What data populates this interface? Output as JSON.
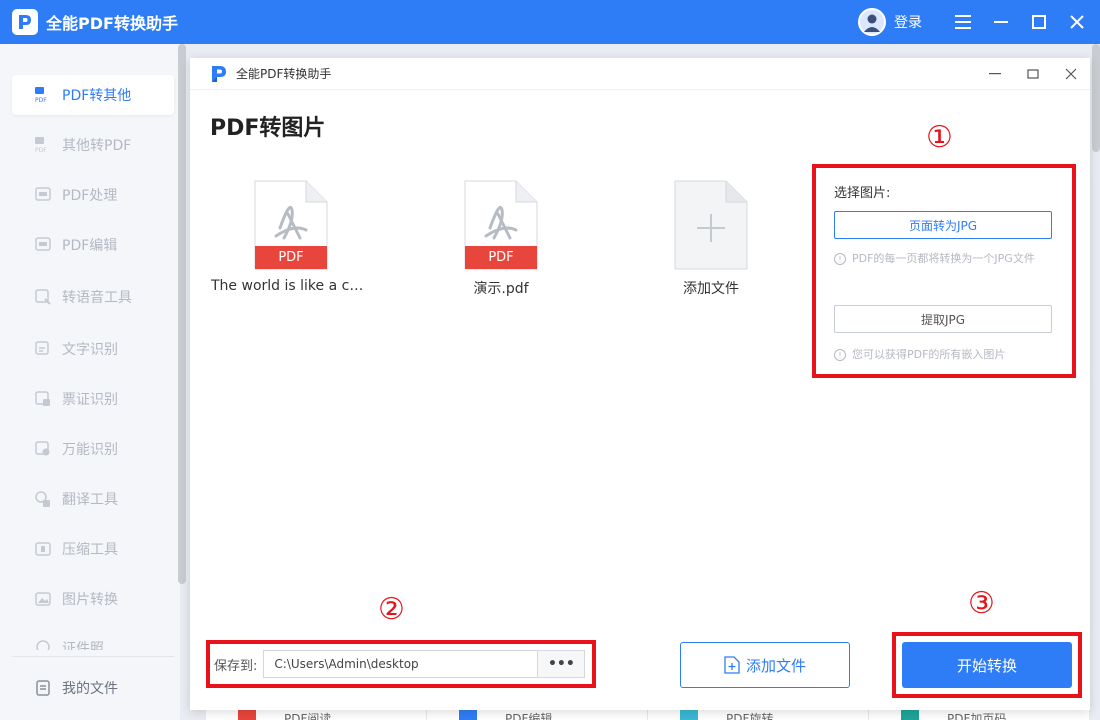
{
  "app": {
    "title": "全能PDF转换助手",
    "login_label": "登录"
  },
  "sidebar": {
    "items": [
      {
        "label": "PDF转其他",
        "icon": "pdf-convert-icon",
        "active": true
      },
      {
        "label": "其他转PDF",
        "icon": "to-pdf-icon"
      },
      {
        "label": "PDF处理",
        "icon": "pdf-process-icon"
      },
      {
        "label": "PDF编辑",
        "icon": "pdf-edit-icon"
      },
      {
        "label": "转语音工具",
        "icon": "voice-icon"
      },
      {
        "label": "文字识别",
        "icon": "ocr-icon"
      },
      {
        "label": "票证识别",
        "icon": "ticket-icon"
      },
      {
        "label": "万能识别",
        "icon": "universal-recognize-icon"
      },
      {
        "label": "翻译工具",
        "icon": "translate-icon"
      },
      {
        "label": "压缩工具",
        "icon": "compress-icon"
      },
      {
        "label": "图片转换",
        "icon": "image-convert-icon"
      },
      {
        "label": "证件照",
        "icon": "id-photo-icon"
      }
    ],
    "my_files_label": "我的文件"
  },
  "dialog": {
    "title": "全能PDF转换助手",
    "heading": "PDF转图片",
    "files": [
      {
        "name": "The world is like a ch...",
        "badge": "PDF"
      },
      {
        "name": "演示.pdf",
        "badge": "PDF"
      }
    ],
    "add_file_tile_label": "添加文件",
    "options": {
      "title": "选择图片:",
      "option1_label": "页面转为JPG",
      "option1_hint": "PDF的每一页都将转换为一个JPG文件",
      "option2_label": "提取JPG",
      "option2_hint": "您可以获得PDF的所有嵌入图片"
    },
    "save": {
      "label": "保存到:",
      "path": "C:\\Users\\Admin\\desktop",
      "browse_label": "•••"
    },
    "add_file_button_label": "添加文件",
    "start_button_label": "开始转换",
    "annotations": [
      "①",
      "②",
      "③"
    ]
  },
  "bottom_tiles": [
    {
      "label": "PDF阅读",
      "color": "#e8453c"
    },
    {
      "label": "PDF编辑",
      "color": "#2f7df6"
    },
    {
      "label": "PDF旋转",
      "color": "#3ab8d6"
    },
    {
      "label": "PDF加页码",
      "color": "#1fa59a"
    }
  ],
  "colors": {
    "accent": "#2f7df6",
    "highlight": "#e8121a",
    "pdf_badge": "#e8453c"
  }
}
